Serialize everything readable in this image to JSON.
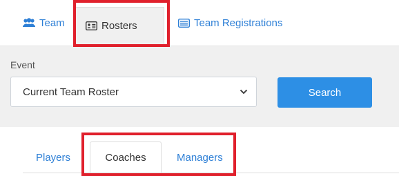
{
  "top_tabs": [
    {
      "label": "Team",
      "icon": "users-icon",
      "active": false
    },
    {
      "label": "Rosters",
      "icon": "id-card-icon",
      "active": true
    },
    {
      "label": "Team Registrations",
      "icon": "list-card-icon",
      "active": false
    }
  ],
  "filter": {
    "event_label": "Event",
    "event_value": "Current Team Roster",
    "search_label": "Search"
  },
  "sub_tabs": [
    {
      "label": "Players",
      "active": false
    },
    {
      "label": "Coaches",
      "active": true
    },
    {
      "label": "Managers",
      "active": false
    }
  ],
  "colors": {
    "link": "#2d7fd6",
    "button": "#2d8fe5",
    "highlight": "#e0202c",
    "panel": "#f0f0f0"
  }
}
